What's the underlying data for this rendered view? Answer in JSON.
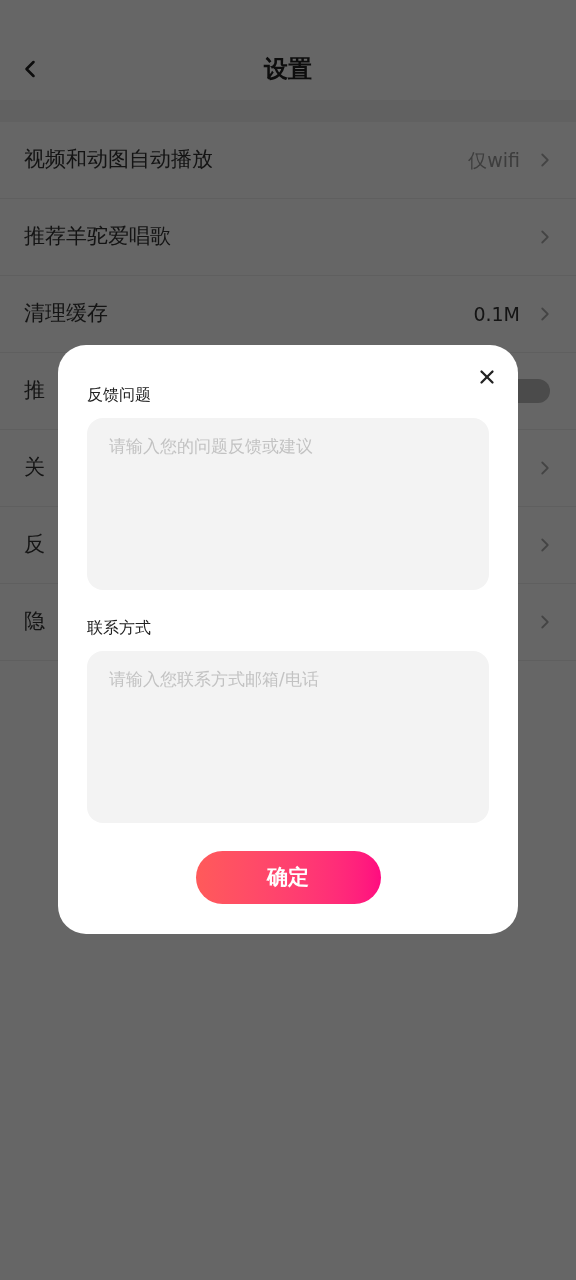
{
  "header": {
    "title": "设置"
  },
  "rows": [
    {
      "kind": "link",
      "label": "视频和动图自动播放",
      "value": "仅wifi"
    },
    {
      "kind": "link",
      "label": "推荐羊驼爱唱歌"
    },
    {
      "kind": "link",
      "label": "清理缓存",
      "value": "0.1M"
    },
    {
      "kind": "toggle",
      "label": "推",
      "on": false
    },
    {
      "kind": "link",
      "label": "关"
    },
    {
      "kind": "link",
      "label": "反"
    },
    {
      "kind": "link",
      "label": "隐"
    }
  ],
  "dialog": {
    "fields": [
      {
        "label": "反馈问题",
        "placeholder": "请输入您的问题反馈或建议"
      },
      {
        "label": "联系方式",
        "placeholder": "请输入您联系方式邮箱/电话"
      }
    ],
    "confirm": "确定"
  }
}
